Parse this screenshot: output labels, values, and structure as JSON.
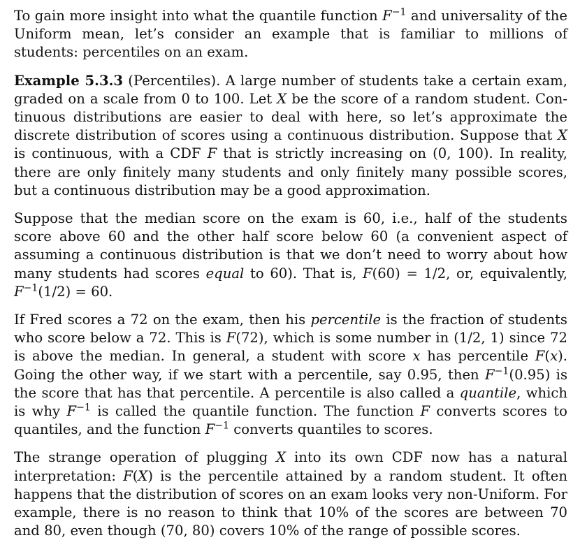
{
  "paragraphs": [
    {
      "segments": [
        {
          "t": "To gain more insight into what the quantile function "
        },
        {
          "m": "F",
          "sup": "−1"
        },
        {
          "t": " and universality of the Uniform mean, let’s consider an example that is familiar to millions of students: percentiles on an exam."
        }
      ]
    },
    {
      "segments": [
        {
          "b": "Example 5.3.3"
        },
        {
          "t": " (Percentiles). A large number of students take a certain exam, graded on a scale from 0 to 100. Let "
        },
        {
          "m": "X"
        },
        {
          "t": " be the score of a random student. Con­tinuous distributions are easier to deal with here, so let’s approximate the discrete distribution of scores using a continuous distribution. Suppose that "
        },
        {
          "m": "X"
        },
        {
          "t": " is continuous, with a CDF "
        },
        {
          "m": "F"
        },
        {
          "t": " that is strictly increasing on (0, 100). In reality, there are only finitely many students and only finitely many possible scores, but a continuous distribution may be a good approximation."
        }
      ]
    },
    {
      "segments": [
        {
          "t": "Suppose that the median score on the exam is 60, i.e., half of the students score above 60 and the other half score below 60 (a convenient aspect of assuming a continuous distribution is that we don’t need to worry about how many students had scores "
        },
        {
          "e": "equal"
        },
        {
          "t": " to 60). That is, "
        },
        {
          "m": "F"
        },
        {
          "t": "(60) = 1/2, or, equivalently, "
        },
        {
          "m": "F",
          "sup": "−1"
        },
        {
          "t": "(1/2) = 60."
        }
      ]
    },
    {
      "segments": [
        {
          "t": "If Fred scores a 72 on the exam, then his "
        },
        {
          "e": "percentile"
        },
        {
          "t": " is the fraction of students who score below a 72. This is "
        },
        {
          "m": "F"
        },
        {
          "t": "(72), which is some number in (1/2, 1) since 72 is above the median. In general, a student with score "
        },
        {
          "m": "x"
        },
        {
          "t": " has percentile "
        },
        {
          "m": "F"
        },
        {
          "t": "("
        },
        {
          "m": "x"
        },
        {
          "t": "). Going the other way, if we start with a percentile, say 0.95, then "
        },
        {
          "m": "F",
          "sup": "−1"
        },
        {
          "t": "(0.95) is the score that has that percentile. A percentile is also called a "
        },
        {
          "e": "quantile"
        },
        {
          "t": ", which is why "
        },
        {
          "m": "F",
          "sup": "−1"
        },
        {
          "t": " is called the quantile function. The function "
        },
        {
          "m": "F"
        },
        {
          "t": " converts scores to quantiles, and the function "
        },
        {
          "m": "F",
          "sup": "−1"
        },
        {
          "t": " converts quantiles to scores."
        }
      ]
    },
    {
      "segments": [
        {
          "t": "The strange operation of plugging "
        },
        {
          "m": "X"
        },
        {
          "t": " into its own CDF now has a natural interpre­tation: "
        },
        {
          "m": "F"
        },
        {
          "t": "("
        },
        {
          "m": "X"
        },
        {
          "t": ") is the percentile attained by a random student. It often happens that the distribution of scores on an exam looks very non-Uniform. For example, there is no reason to think that 10% of the scores are between 70 and 80, even though (70, 80) covers 10% of the range of possible scores."
        }
      ]
    }
  ]
}
